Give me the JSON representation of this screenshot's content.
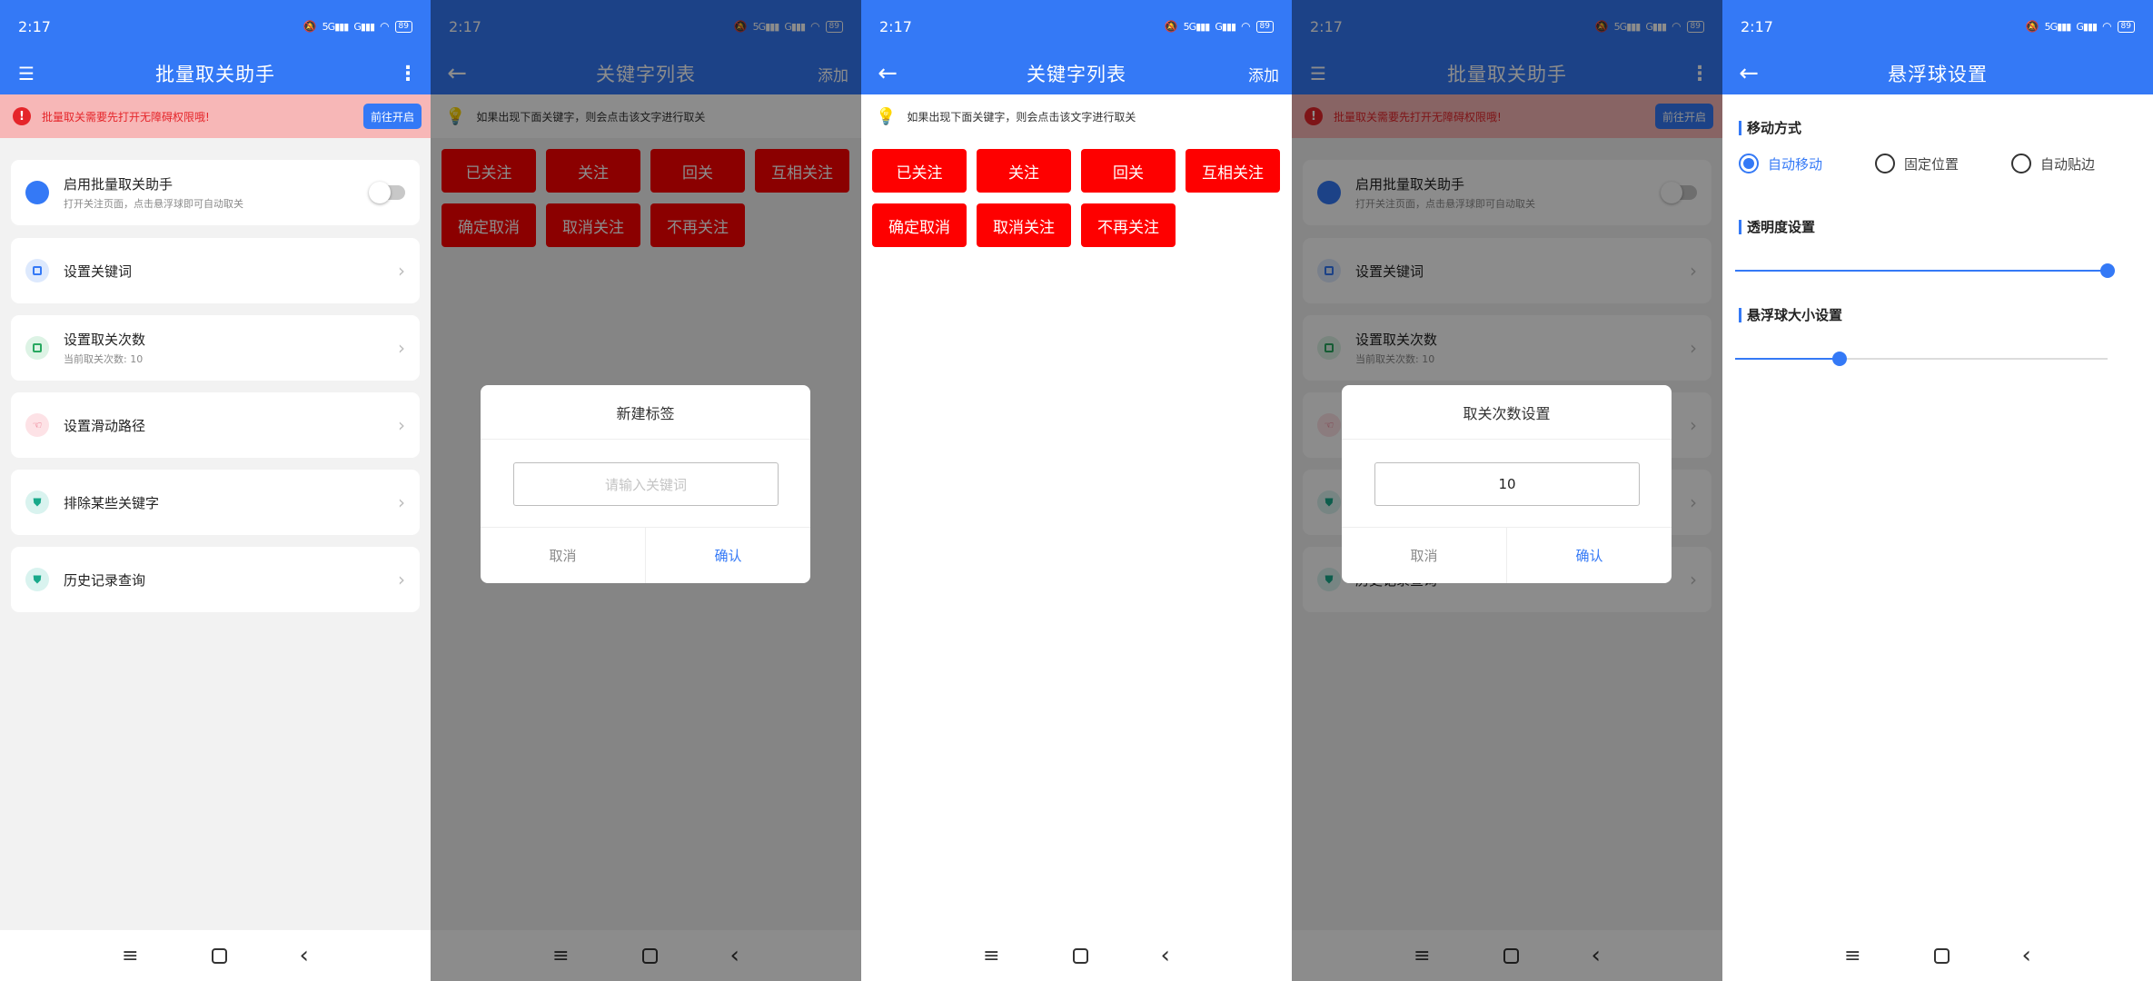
{
  "status": {
    "time": "2:17",
    "net_5g": "5G",
    "net_4g": "G",
    "battery": "89"
  },
  "colors": {
    "primary": "#3479f6",
    "warning_bg": "#f7b7b7",
    "warning_text": "#e5252a",
    "chip_red": "#fe0000"
  },
  "home": {
    "title": "批量取关助手",
    "warning": {
      "text": "批量取关需要先打开无障碍权限哦!",
      "button": "前往开启"
    },
    "enable": {
      "title": "启用批量取关助手",
      "subtitle": "打开关注页面，点击悬浮球即可自动取关",
      "enabled": false
    },
    "items": [
      {
        "title": "设置关键词",
        "subtitle": ""
      },
      {
        "title": "设置取关次数",
        "subtitle": "当前取关次数: 10"
      },
      {
        "title": "设置滑动路径",
        "subtitle": ""
      },
      {
        "title": "排除某些关键字",
        "subtitle": ""
      },
      {
        "title": "历史记录查询",
        "subtitle": ""
      }
    ]
  },
  "keywords": {
    "title": "关键字列表",
    "add_label": "添加",
    "hint": "如果出现下面关键字，则会点击该文字进行取关",
    "chips": [
      "已关注",
      "关注",
      "回关",
      "互相关注",
      "确定取消",
      "取消关注",
      "不再关注"
    ]
  },
  "new_tag_dialog": {
    "title": "新建标签",
    "placeholder": "请输入关键词",
    "cancel": "取消",
    "confirm": "确认"
  },
  "count_dialog": {
    "title": "取关次数设置",
    "value": "10",
    "cancel": "取消",
    "confirm": "确认"
  },
  "float_settings": {
    "title": "悬浮球设置",
    "move_mode": {
      "label": "移动方式",
      "options": [
        "自动移动",
        "固定位置",
        "自动贴边"
      ],
      "selected": 0
    },
    "opacity": {
      "label": "透明度设置",
      "value": 1.0
    },
    "size": {
      "label": "悬浮球大小设置",
      "value": 0.28
    }
  }
}
